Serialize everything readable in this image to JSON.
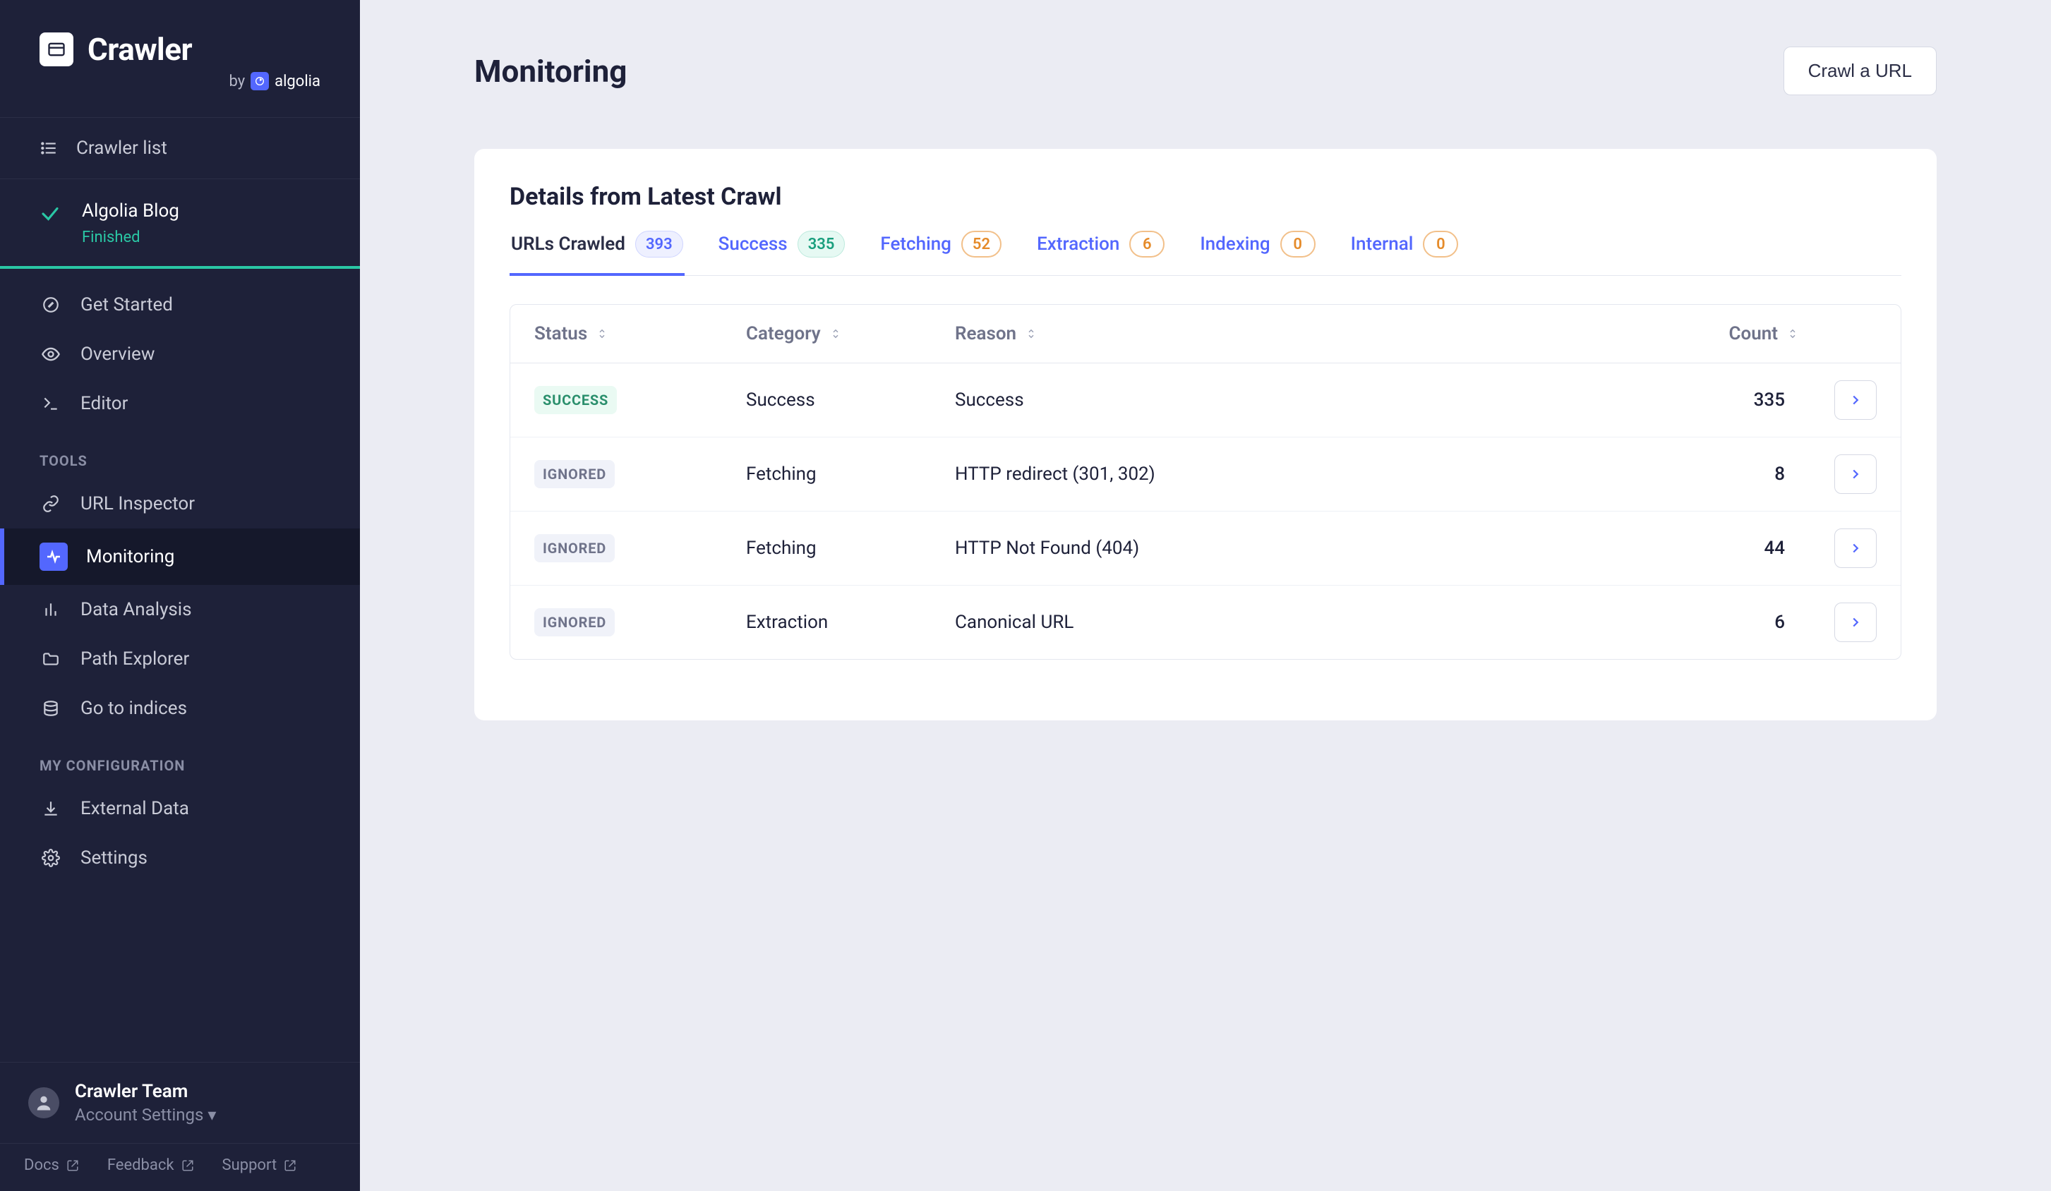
{
  "brand": {
    "name": "Crawler",
    "by": "by",
    "vendor": "algolia"
  },
  "crawler_list_label": "Crawler list",
  "project": {
    "name": "Algolia Blog",
    "status": "Finished"
  },
  "nav": {
    "get_started": "Get Started",
    "overview": "Overview",
    "editor": "Editor",
    "tools_header": "TOOLS",
    "url_inspector": "URL Inspector",
    "monitoring": "Monitoring",
    "data_analysis": "Data Analysis",
    "path_explorer": "Path Explorer",
    "go_to_indices": "Go to indices",
    "config_header": "MY CONFIGURATION",
    "external_data": "External Data",
    "settings": "Settings"
  },
  "user": {
    "team": "Crawler Team",
    "account": "Account Settings ▾"
  },
  "footer": {
    "docs": "Docs",
    "feedback": "Feedback",
    "support": "Support"
  },
  "page": {
    "title": "Monitoring",
    "crawl_button": "Crawl a URL"
  },
  "panel": {
    "title": "Details from Latest Crawl"
  },
  "tabs": [
    {
      "label": "URLs Crawled",
      "count": "393",
      "color": "blue",
      "active": true
    },
    {
      "label": "Success",
      "count": "335",
      "color": "green",
      "active": false
    },
    {
      "label": "Fetching",
      "count": "52",
      "color": "orange",
      "active": false
    },
    {
      "label": "Extraction",
      "count": "6",
      "color": "orange",
      "active": false
    },
    {
      "label": "Indexing",
      "count": "0",
      "color": "orange",
      "active": false
    },
    {
      "label": "Internal",
      "count": "0",
      "color": "orange",
      "active": false
    }
  ],
  "columns": {
    "status": "Status",
    "category": "Category",
    "reason": "Reason",
    "count": "Count"
  },
  "rows": [
    {
      "status": "SUCCESS",
      "status_kind": "success",
      "category": "Success",
      "reason": "Success",
      "count": "335"
    },
    {
      "status": "IGNORED",
      "status_kind": "ignored",
      "category": "Fetching",
      "reason": "HTTP redirect (301, 302)",
      "count": "8"
    },
    {
      "status": "IGNORED",
      "status_kind": "ignored",
      "category": "Fetching",
      "reason": "HTTP Not Found (404)",
      "count": "44"
    },
    {
      "status": "IGNORED",
      "status_kind": "ignored",
      "category": "Extraction",
      "reason": "Canonical URL",
      "count": "6"
    }
  ]
}
